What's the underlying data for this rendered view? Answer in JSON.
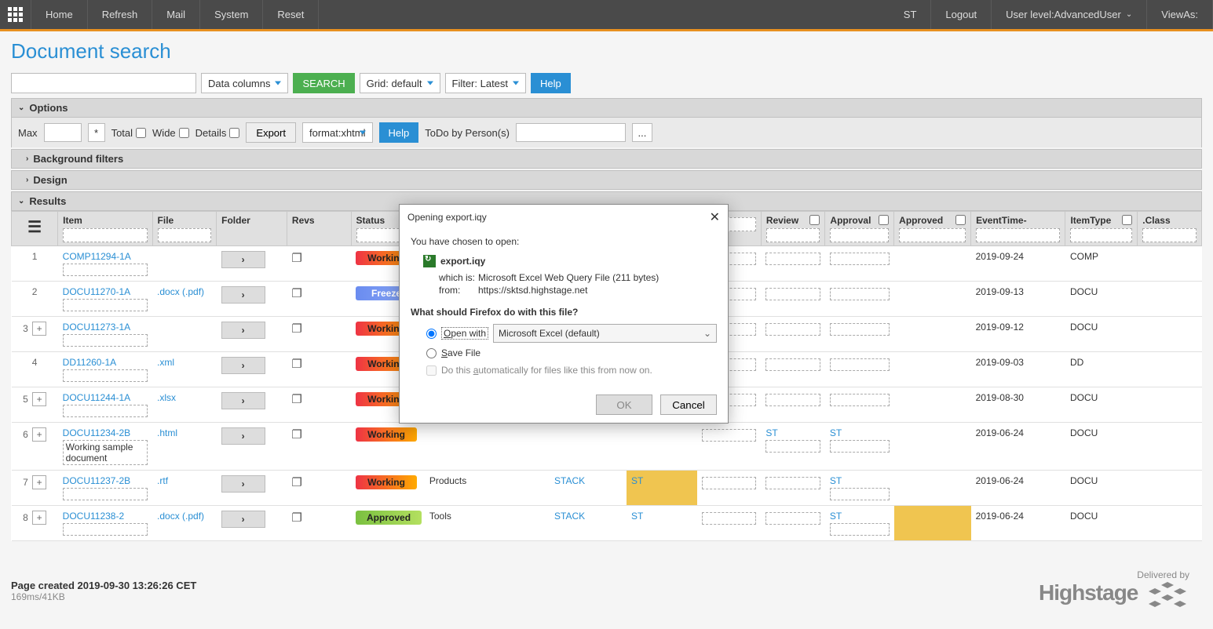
{
  "topbar": {
    "left": [
      "Home",
      "Refresh",
      "Mail",
      "System",
      "Reset"
    ],
    "right": {
      "user_short": "ST",
      "logout": "Logout",
      "user_level_label": "User level:",
      "user_level_value": "AdvancedUser",
      "view_as": "ViewAs:"
    }
  },
  "page_title": "Document search",
  "toolbar": {
    "data_columns": "Data columns",
    "search": "SEARCH",
    "grid": "Grid: default",
    "filter": "Filter: Latest",
    "help": "Help"
  },
  "sections": {
    "options": "Options",
    "background_filters": "Background filters",
    "design": "Design",
    "results": "Results"
  },
  "options_panel": {
    "max": "Max",
    "star": "*",
    "total": "Total",
    "wide": "Wide",
    "details": "Details",
    "export": "Export",
    "format": "format:xhtml",
    "help": "Help",
    "todo_label": "ToDo by Person(s)",
    "ellipsis": "..."
  },
  "columns": [
    "",
    "Item",
    "File",
    "Folder",
    "Revs",
    "Status",
    "",
    "",
    "",
    "",
    "Review",
    "Approval",
    "Approved",
    "EventTime-",
    "ItemType",
    ".Class"
  ],
  "rows": [
    {
      "num": "1",
      "plus": false,
      "item": "COMP11294-1A",
      "file": "",
      "status": "Working",
      "statusClass": "status-working",
      "col7": "",
      "col8": "",
      "review": "",
      "approval": "",
      "approved": "",
      "eventtime": "2019-09-24",
      "itemtype": "COMP"
    },
    {
      "num": "2",
      "plus": false,
      "item": "DOCU11270-1A",
      "file": ".docx (.pdf)",
      "status": "Freeze",
      "statusClass": "status-freeze",
      "col7": "",
      "col8": "",
      "review": "",
      "approval": "",
      "approved": "",
      "eventtime": "2019-09-13",
      "itemtype": "DOCU"
    },
    {
      "num": "3",
      "plus": true,
      "item": "DOCU11273-1A",
      "file": "",
      "status": "Working",
      "statusClass": "status-working",
      "col7": "",
      "col8": "",
      "review": "",
      "approval": "",
      "approved": "",
      "eventtime": "2019-09-12",
      "itemtype": "DOCU"
    },
    {
      "num": "4",
      "plus": false,
      "item": "DD11260-1A",
      "file": ".xml",
      "status": "Working",
      "statusClass": "status-working",
      "col7": "",
      "col8": "",
      "review": "",
      "approval": "",
      "approved": "",
      "eventtime": "2019-09-03",
      "itemtype": "DD"
    },
    {
      "num": "5",
      "plus": true,
      "item": "DOCU11244-1A",
      "file": ".xlsx",
      "status": "Working",
      "statusClass": "status-working",
      "col7": "",
      "col8": "",
      "review": "",
      "approval": "",
      "approved": "",
      "eventtime": "2019-08-30",
      "itemtype": "DOCU"
    },
    {
      "num": "6",
      "plus": true,
      "item": "DOCU11234-2B",
      "item_sub": "Working sample document",
      "file": ".html",
      "status": "Working",
      "statusClass": "status-working",
      "col7": "",
      "col8": "",
      "review": "ST",
      "approval": "ST",
      "approved": "",
      "eventtime": "2019-06-24",
      "itemtype": "DOCU"
    },
    {
      "num": "7",
      "plus": true,
      "item": "DOCU11237-2B",
      "file": ".rtf",
      "status": "Working",
      "statusClass": "status-working",
      "area": "Products",
      "col7": "STACK",
      "col8": "ST",
      "col8yellow": true,
      "review": "",
      "approval": "ST",
      "approved": "",
      "eventtime": "2019-06-24",
      "itemtype": "DOCU"
    },
    {
      "num": "8",
      "plus": true,
      "item": "DOCU11238-2",
      "file": ".docx (.pdf)",
      "status": "Approved",
      "statusClass": "status-approved",
      "area": "Tools",
      "col7": "STACK",
      "col8": "ST",
      "review": "",
      "approval": "ST",
      "approved": "",
      "approved_yellow": true,
      "eventtime": "2019-06-24",
      "itemtype": "DOCU"
    }
  ],
  "footer": {
    "created": "Page created 2019-09-30 13:26:26 CET",
    "stats": "169ms/41KB",
    "delivered": "Delivered by",
    "brand": "Highstage"
  },
  "dialog": {
    "title": "Opening export.iqy",
    "chosen": "You have chosen to open:",
    "filename": "export.iqy",
    "which_is_label": "which is:",
    "which_is": "Microsoft Excel Web Query File (211 bytes)",
    "from_label": "from:",
    "from": "https://sktsd.highstage.net",
    "question": "What should Firefox do with this file?",
    "open_with": "Open with",
    "open_app": "Microsoft Excel (default)",
    "save_file": "Save File",
    "auto": "Do this automatically for files like this from now on.",
    "ok": "OK",
    "cancel": "Cancel"
  }
}
